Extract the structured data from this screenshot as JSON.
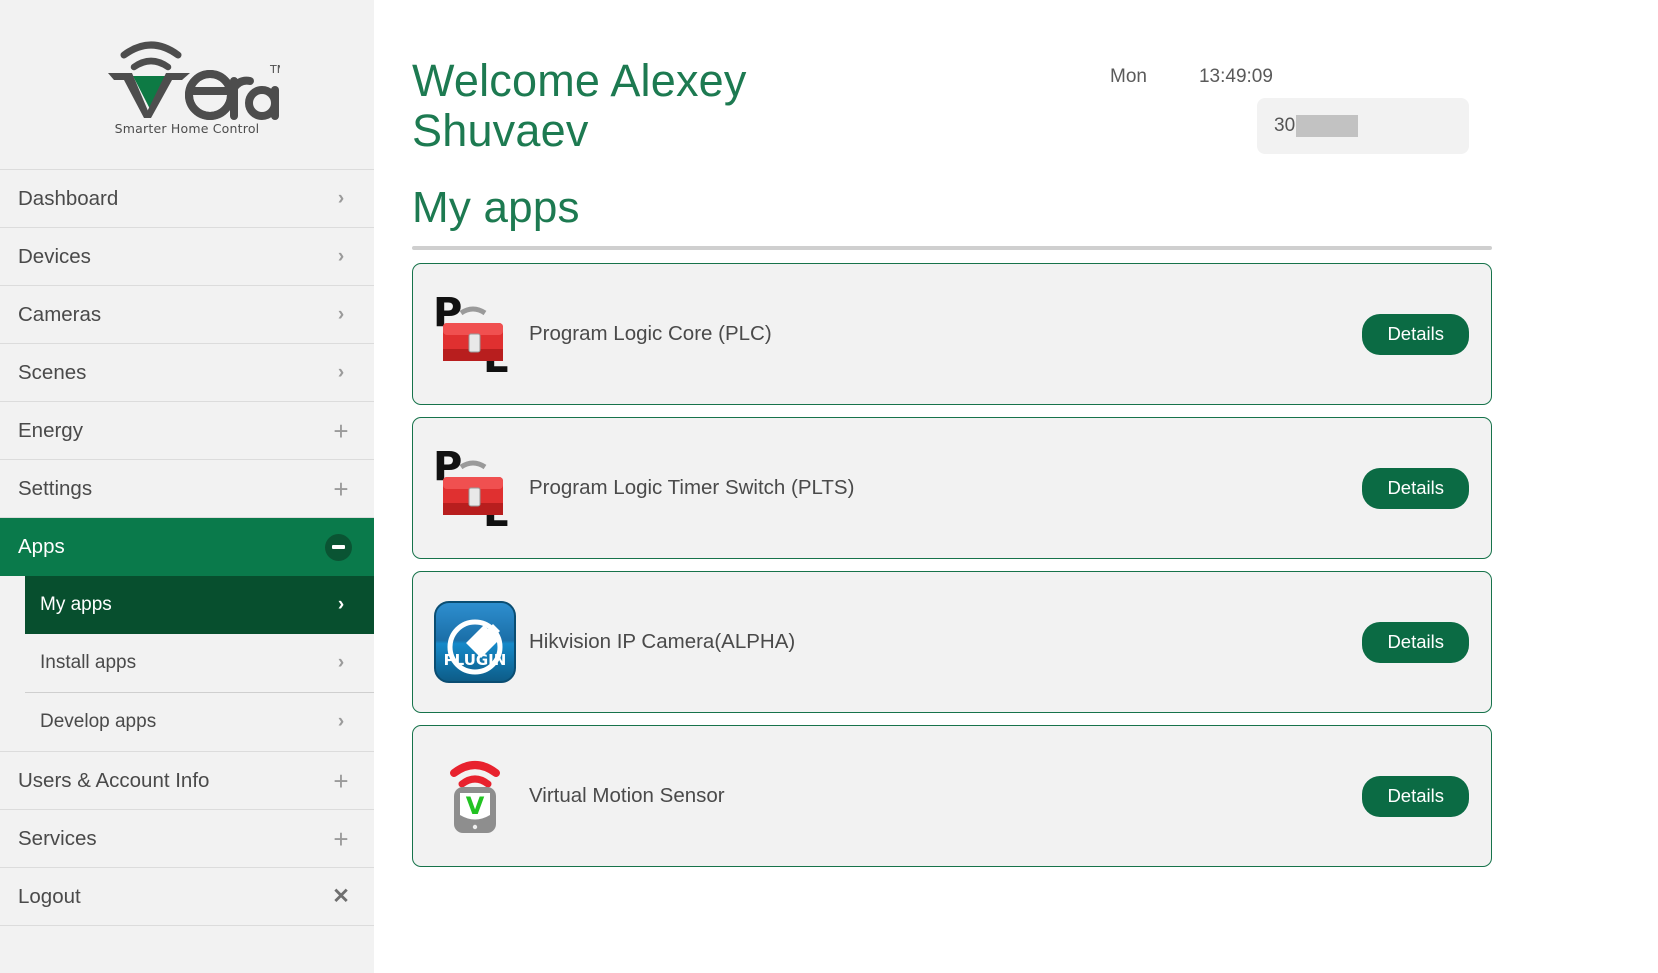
{
  "brand": {
    "name": "vera",
    "tagline": "Smarter Home Control",
    "trademark": "TM"
  },
  "sidebar": {
    "items": [
      {
        "label": "Dashboard",
        "indicator": "chevron-right-icon",
        "glyph": "›"
      },
      {
        "label": "Devices",
        "indicator": "chevron-right-icon",
        "glyph": "›"
      },
      {
        "label": "Cameras",
        "indicator": "chevron-right-icon",
        "glyph": "›"
      },
      {
        "label": "Scenes",
        "indicator": "chevron-right-icon",
        "glyph": "›"
      },
      {
        "label": "Energy",
        "indicator": "plus-icon",
        "glyph": "+"
      },
      {
        "label": "Settings",
        "indicator": "plus-icon",
        "glyph": "+"
      }
    ],
    "apps_group": {
      "label": "Apps",
      "indicator": "minus-circle-icon",
      "expanded": true,
      "children": [
        {
          "label": "My apps",
          "indicator": "chevron-right-icon",
          "glyph": "›",
          "active": true
        },
        {
          "label": "Install apps",
          "indicator": "chevron-right-icon",
          "glyph": "›",
          "active": false
        },
        {
          "label": "Develop apps",
          "indicator": "chevron-right-icon",
          "glyph": "›",
          "active": false
        }
      ]
    },
    "bottom_items": [
      {
        "label": "Users & Account Info",
        "indicator": "plus-icon",
        "glyph": "+"
      },
      {
        "label": "Services",
        "indicator": "plus-icon",
        "glyph": "+"
      },
      {
        "label": "Logout",
        "indicator": "close-icon",
        "glyph": "✕"
      }
    ]
  },
  "header": {
    "welcome": "Welcome Alexey Shuvaev",
    "day": "Mon",
    "time": "13:49:09",
    "status_number": "30"
  },
  "main": {
    "section_title": "My apps",
    "details_label": "Details",
    "apps": [
      {
        "name": "Program Logic Core (PLC)",
        "icon": "toolbox-pl-icon",
        "details_label": "Details"
      },
      {
        "name": "Program Logic Timer Switch (PLTS)",
        "icon": "toolbox-pl-icon",
        "details_label": "Details"
      },
      {
        "name": "Hikvision IP Camera(ALPHA)",
        "icon": "plugin-badge-icon",
        "details_label": "Details"
      },
      {
        "name": "Virtual Motion Sensor",
        "icon": "motion-sensor-icon",
        "details_label": "Details"
      }
    ]
  },
  "colors": {
    "brand_green": "#1d7a51",
    "active_green": "#0a7a4b",
    "active_sub_green": "#074f2e",
    "button_green": "#0b6b44",
    "sidebar_bg": "#f2f2f2",
    "card_border": "#17734b"
  }
}
